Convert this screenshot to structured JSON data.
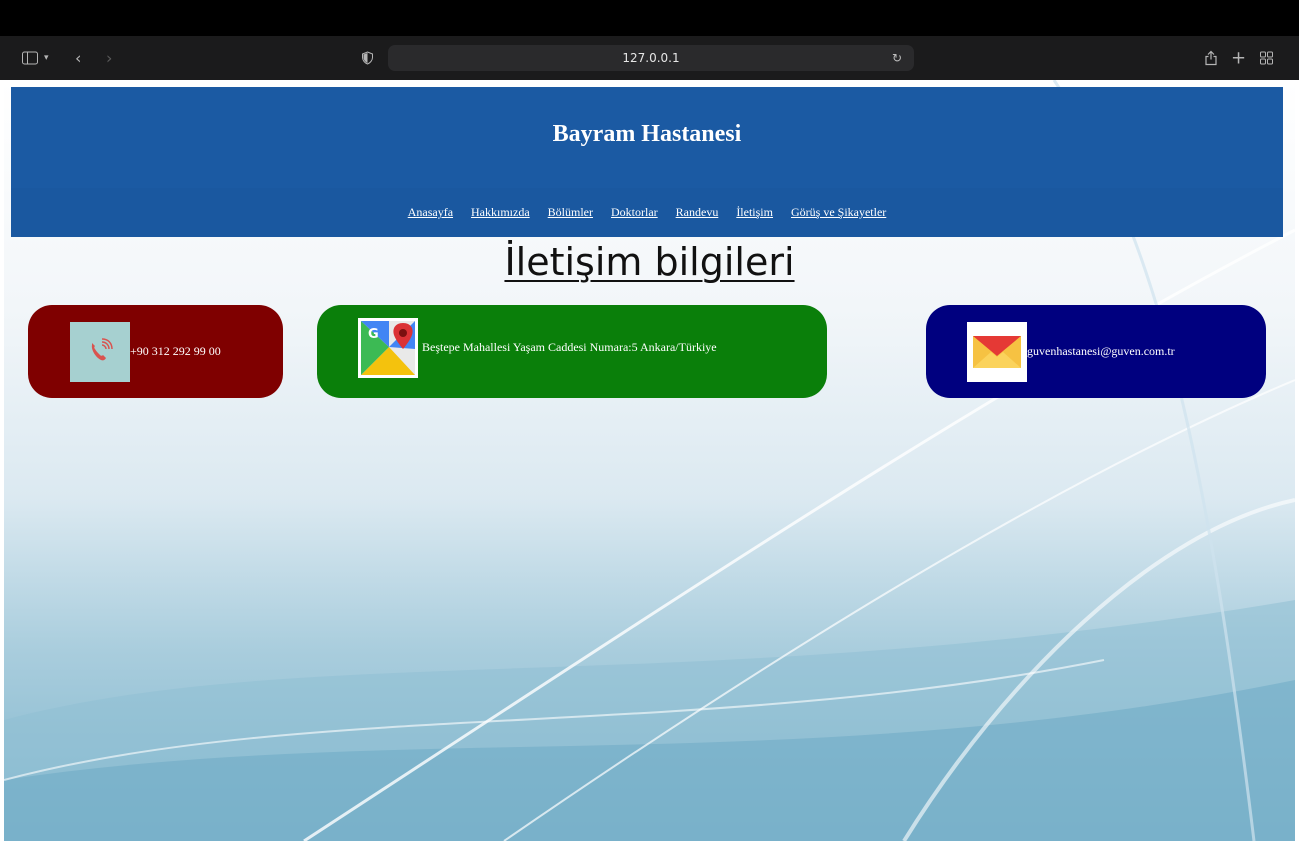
{
  "browser": {
    "url": "127.0.0.1"
  },
  "site": {
    "title": "Bayram Hastanesi",
    "nav": [
      {
        "label": "Anasayfa"
      },
      {
        "label": "Hakkımızda"
      },
      {
        "label": "Bölümler"
      },
      {
        "label": "Doktorlar"
      },
      {
        "label": "Randevu"
      },
      {
        "label": "İletişim"
      },
      {
        "label": "Görüş ve Şikayetler"
      }
    ]
  },
  "page": {
    "heading": "İletişim bilgileri"
  },
  "contacts": {
    "phone": {
      "text": "+90 312 292 99 00",
      "icon": "phone-icon",
      "color": "#7f0000"
    },
    "address": {
      "text": "Beştepe Mahallesi Yaşam Caddesi Numara:5 Ankara/Türkiye",
      "icon": "google-maps-icon",
      "color": "#0a7f0a"
    },
    "email": {
      "text": "guvenhastanesi@guven.com.tr",
      "icon": "mail-icon",
      "color": "#00007f"
    }
  },
  "colors": {
    "header": "#1b5aa3"
  }
}
